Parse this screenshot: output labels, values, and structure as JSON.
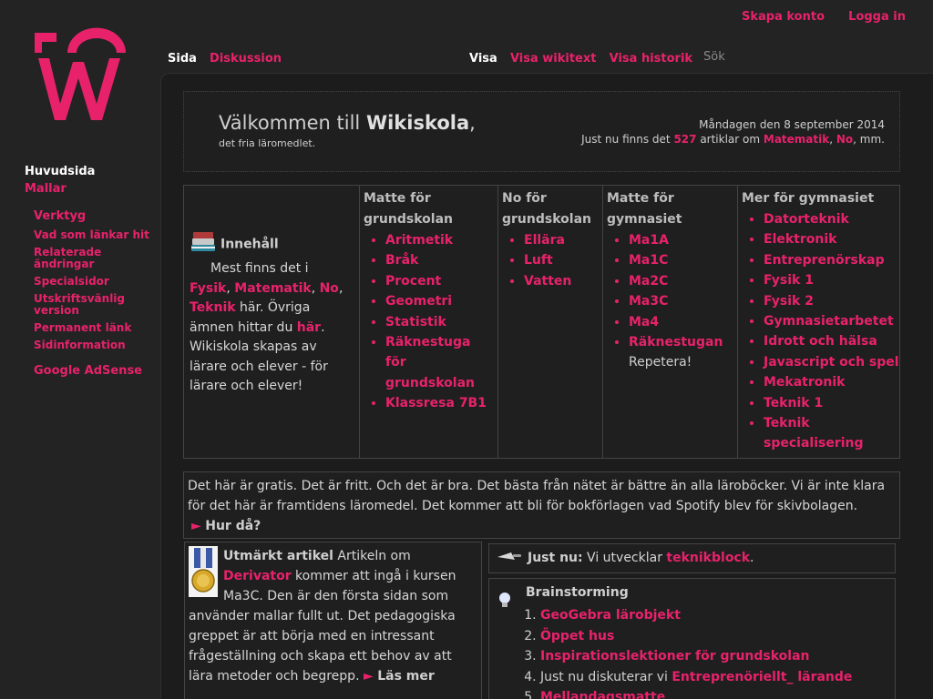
{
  "personal": {
    "create_account": "Skapa konto",
    "login": "Logga in"
  },
  "sidebar": {
    "main_page": "Huvudsida",
    "templates": "Mallar",
    "tools_header": "Verktyg",
    "tools": [
      "Vad som länkar hit",
      "Relaterade ändringar",
      "Specialsidor",
      "Utskriftsvänlig version",
      "Permanent länk",
      "Sidinformation"
    ],
    "adsense": "Google AdSense"
  },
  "tabs": {
    "page": "Sida",
    "discussion": "Diskussion",
    "view": "Visa",
    "view_source": "Visa wikitext",
    "history": "Visa historik",
    "search_placeholder": "Sök"
  },
  "welcome": {
    "prefix": "Välkommen till ",
    "site": "Wikiskola",
    "comma": ",",
    "tagline": "det fria läromedlet.",
    "date": "Måndagen den 8 september 2014",
    "stat_prefix": "Just nu finns det ",
    "count": "527",
    "stat_mid": " artiklar om ",
    "subject1": "Matematik",
    "sep": ", ",
    "subject2": "No",
    "stat_suffix": ", mm."
  },
  "intro": {
    "title": "Innehåll",
    "line1": "Mest finns det i",
    "fysik": "Fysik",
    "matematik": "Matematik",
    "no": "No",
    "teknik": "Teknik",
    "har_suffix": " här.",
    "ovriga": "Övriga ämnen hittar du ",
    "har_link": "här",
    "wikiskola_text": "Wikiskola skapas av lärare och elever - för lärare och elever!"
  },
  "columns": [
    {
      "title": "Matte för grundskolan",
      "items": [
        "Aritmetik",
        "Bråk",
        "Procent",
        "Geometri",
        "Statistik",
        "Räknestuga för grundskolan",
        "Klassresa 7B1"
      ]
    },
    {
      "title": "No för grundskolan",
      "items": [
        "Ellära",
        "Luft",
        "Vatten"
      ]
    },
    {
      "title": "Matte för gymnasiet",
      "items": [
        "Ma1A",
        "Ma1C",
        "Ma2C",
        "Ma3C",
        "Ma4",
        "Räknestugan"
      ],
      "extra": "Repetera!"
    },
    {
      "title": "Mer för gymnasiet",
      "items": [
        "Datorteknik",
        "Elektronik",
        "Entreprenörskap",
        "Fysik 1",
        "Fysik 2",
        "Gymnasietarbetet",
        "Idrott och hälsa",
        "Javascript och spel",
        "Mekatronik",
        "Teknik 1",
        "Teknik specialisering"
      ]
    }
  ],
  "free": {
    "text": "Det här är gratis. Det är fritt. Och det är bra. Det bästa från nätet är bättre än alla läroböcker. Vi är inte klara för det här är framtidens läromedel. Det kommer att bli för bokförlagen vad Spotify blev för skivbolagen.",
    "how": "Hur då?"
  },
  "featured": {
    "title": "Utmärkt artikel",
    "pre": " Artikeln om ",
    "link": "Derivator",
    "post": " kommer att ingå i kursen Ma3C. Den är den första sidan som använder mallar fullt ut. Det pedagogiska greppet är att börja med en intressant frågeställning och skapa ett behov av att lära metoder och begrepp.",
    "more": "Läs mer"
  },
  "now": {
    "label": "Just nu:",
    "text": " Vi utvecklar ",
    "link": "teknikblock",
    "end": "."
  },
  "brainstorm": {
    "title": "Brainstorming",
    "items": [
      {
        "pre": "",
        "link": "GeoGebra lärobjekt"
      },
      {
        "pre": "",
        "link": "Öppet hus"
      },
      {
        "pre": "",
        "link": "Inspirationslektioner för grundskolan"
      },
      {
        "pre": "Just nu diskuterar vi ",
        "link": "Entreprenöriellt_ lärande"
      },
      {
        "pre": "",
        "link": "Mellandagsmatte"
      }
    ]
  },
  "colors": {
    "accent": "#e8226a",
    "background": "#232323",
    "content_bg": "#1c1c1c"
  },
  "icons": [
    "books-icon",
    "medal-icon",
    "trowel-icon",
    "lightbulb-icon",
    "arrow-right-icon",
    "logo"
  ]
}
